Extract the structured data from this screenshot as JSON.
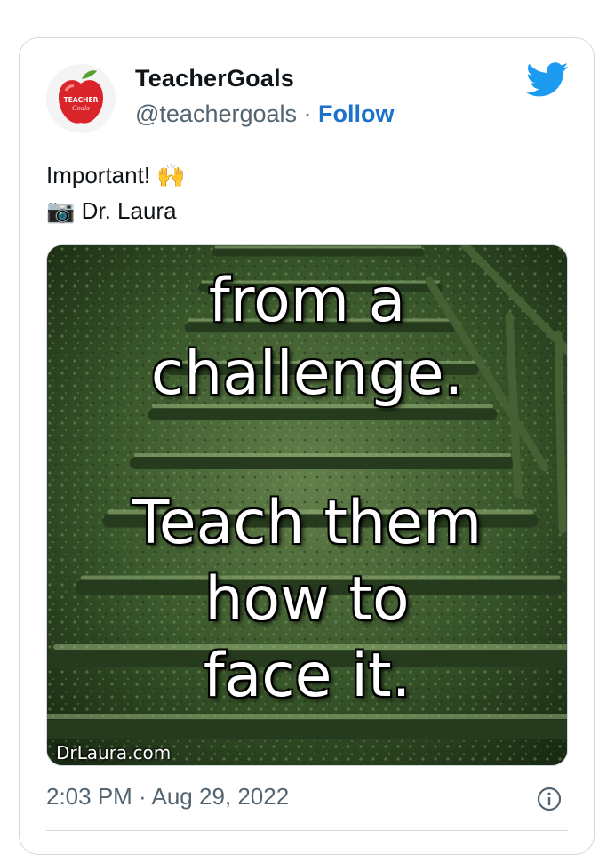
{
  "tweet": {
    "author": {
      "display_name": "TeacherGoals",
      "handle": "@teachergoals",
      "separator": "·",
      "follow_label": "Follow",
      "avatar_text_top": "TEACHER",
      "avatar_text_bottom": "Goals"
    },
    "text_line_1": "Important! 🙌",
    "text_line_2_icon": "📷",
    "text_line_2": "Dr. Laura",
    "media": {
      "quote_lines": [
        "from a",
        "challenge.",
        "Teach them",
        "how to",
        "face it."
      ],
      "watermark": "DrLaura.com"
    },
    "timestamp": "2:03 PM · Aug 29, 2022"
  },
  "icons": {
    "bird": "twitter-bird-icon",
    "info": "info-icon"
  },
  "colors": {
    "follow": "#1d73c9",
    "twitter_blue": "#1d9bf0",
    "muted": "#536471"
  }
}
